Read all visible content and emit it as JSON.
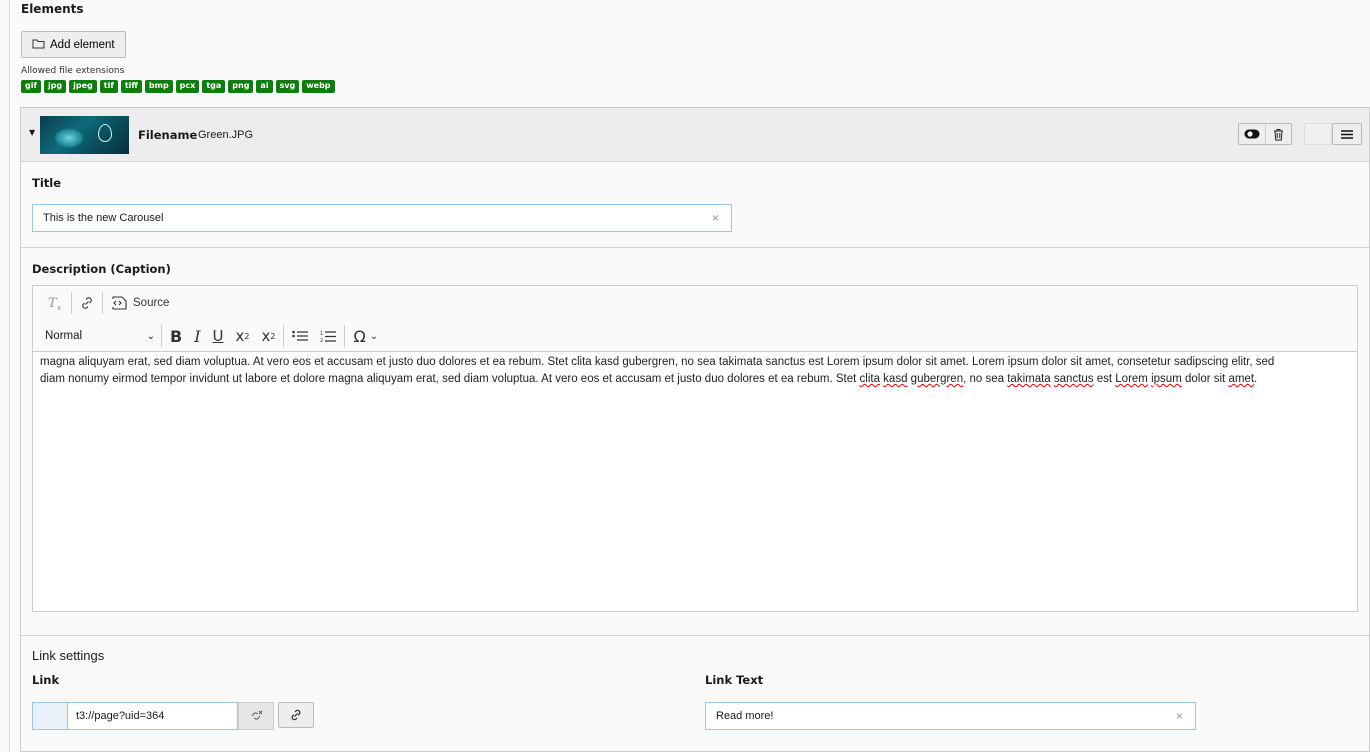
{
  "section": {
    "title": "Elements"
  },
  "add_element": {
    "label": "Add element",
    "icon": "folder-icon"
  },
  "allowed_extensions": {
    "label": "Allowed file extensions",
    "items": [
      "gif",
      "jpg",
      "jpeg",
      "tif",
      "tiff",
      "bmp",
      "pcx",
      "tga",
      "png",
      "ai",
      "svg",
      "webp"
    ],
    "badge_color": "#107c10"
  },
  "file_panel": {
    "filename_label": "Filename",
    "filename_value": "Green.JPG",
    "actions": [
      "toggle-visibility-icon",
      "trash-icon",
      "menu-icon"
    ]
  },
  "title_field": {
    "label": "Title",
    "value": "This is the new Carousel"
  },
  "description_field": {
    "label": "Description (Caption)",
    "toolbar": {
      "source_label": "Source",
      "format_label": "Normal"
    },
    "body": {
      "line1": "magna aliquyam erat, sed diam voluptua. At vero eos et accusam et justo duo dolores et ea rebum. Stet clita kasd gubergren, no sea takimata sanctus est Lorem ipsum dolor sit amet. Lorem ipsum dolor sit amet, consetetur sadipscing elitr, sed",
      "line2_prefix": "diam nonumy eirmod tempor invidunt ut labore et dolore magna aliquyam erat, sed diam voluptua. At vero eos et accusam et justo duo dolores et ea rebum. Stet ",
      "w_clita": "clita",
      "w_kasd": "kasd",
      "w_gubergren": "gubergren",
      "t_no_sea": ", no sea ",
      "w_takimata": "takimata",
      "w_sanctus": "sanctus",
      "t_est": " est ",
      "w_lorem": "Lorem",
      "w_ipsum": "ipsum",
      "t_dolor_sit": " dolor sit ",
      "w_amet": "amet",
      "t_end": "."
    }
  },
  "link_settings": {
    "heading": "Link settings",
    "link_label": "Link",
    "link_value": "t3://page?uid=364",
    "link_text_label": "Link Text",
    "link_text_value": "Read more!"
  },
  "colors": {
    "input_border": "#9ec5e3",
    "header_bg": "#ededed"
  }
}
